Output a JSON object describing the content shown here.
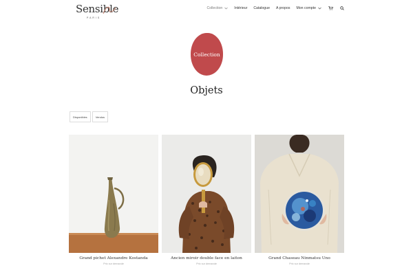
{
  "brand": {
    "name": "Sensible",
    "tagline": "PARIS"
  },
  "nav": {
    "items": [
      {
        "label": "Collection",
        "has_dropdown": true
      },
      {
        "label": "Intérieur",
        "has_dropdown": false
      },
      {
        "label": "Catalogue",
        "has_dropdown": false
      },
      {
        "label": "A propos",
        "has_dropdown": false
      },
      {
        "label": "Mon compte",
        "has_dropdown": true
      }
    ],
    "icons": [
      "cart-icon",
      "search-icon"
    ]
  },
  "badge": {
    "label": "Collection",
    "color": "#c04a4c"
  },
  "page_title": "Objets",
  "filters": [
    "Disponibles",
    "Vendus"
  ],
  "products": [
    {
      "title": "Grand pichet Alexandre Kostanda",
      "price": "Prix sur demande"
    },
    {
      "title": "Ancien miroir double face en laiton",
      "price": "Prix sur demande"
    },
    {
      "title": "Grand Chaseau Ninmatsu Uno",
      "price": "Prix sur demande"
    }
  ]
}
